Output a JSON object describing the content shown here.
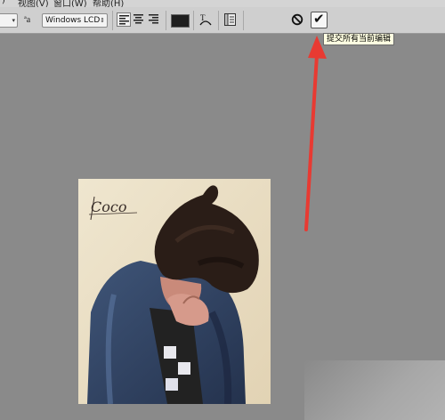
{
  "menu": {
    "items": [
      ")",
      "视图(V)",
      "窗口(W)",
      "帮助(H)"
    ]
  },
  "options_bar": {
    "font_size_value": "",
    "aa_label": "ªa",
    "antialias_value": "Windows LCD",
    "align_selected": "left",
    "text_color": "#1e1e1e",
    "commit_tooltip": "提交所有当前编辑"
  },
  "canvas": {
    "background": "#8a8a8a",
    "signature_text": "Coco"
  },
  "annotation": {
    "arrow_color": "#e83a32"
  }
}
